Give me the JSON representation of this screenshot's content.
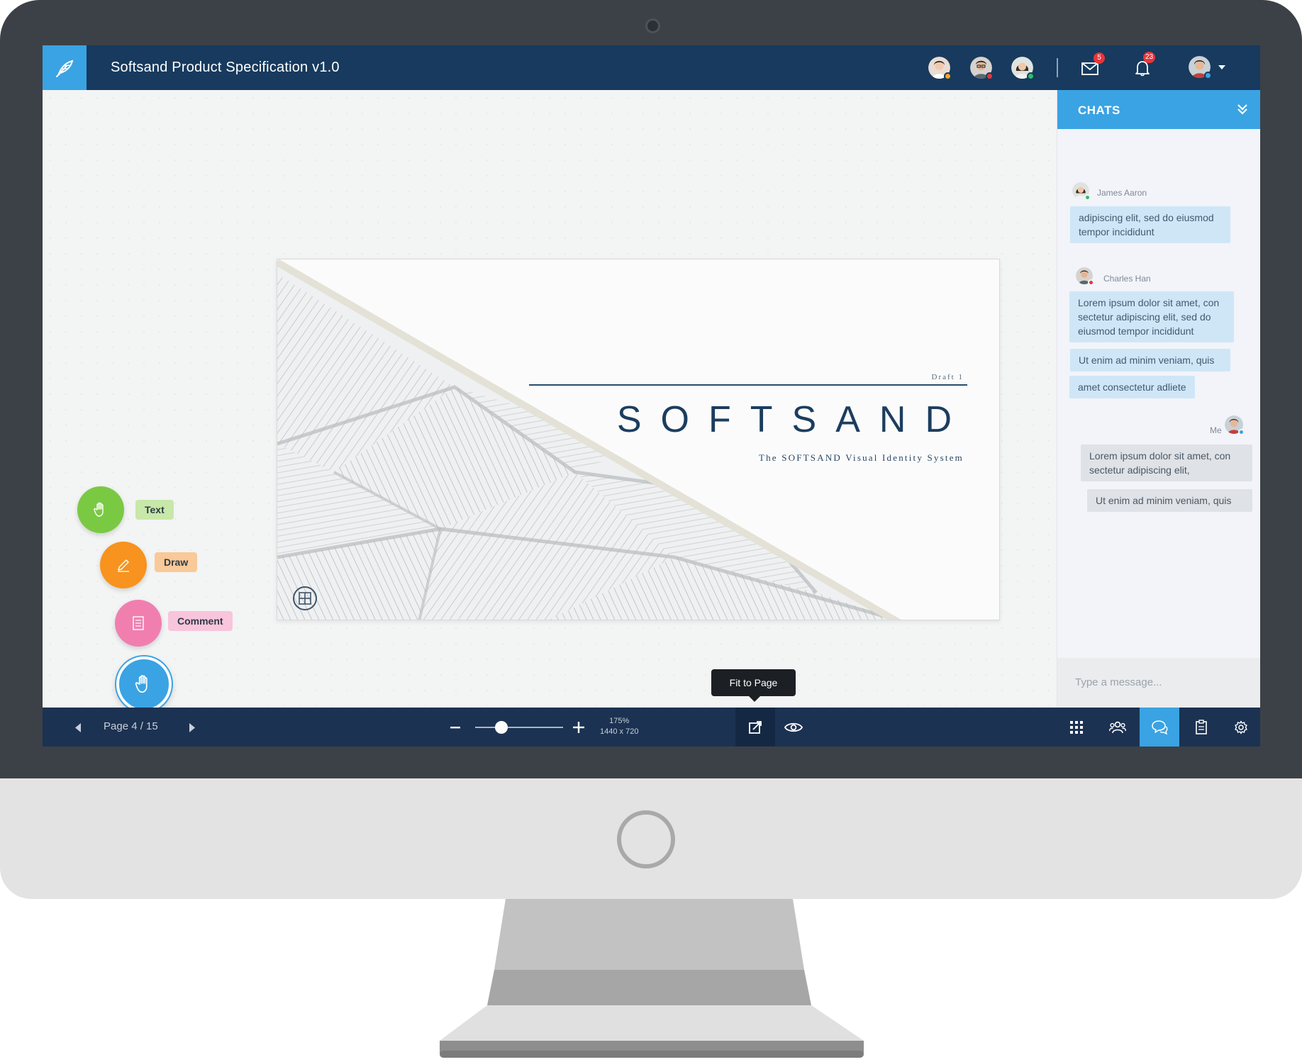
{
  "app": {
    "document_title": "Softsand Product Specification v1.0"
  },
  "header": {
    "collaborators": [
      {
        "avatar": "collaborator-avatar-1",
        "status_color": "#f5a623"
      },
      {
        "avatar": "collaborator-avatar-2",
        "status_color": "#e8343a"
      },
      {
        "avatar": "collaborator-avatar-3",
        "status_color": "#2bbf6a"
      }
    ],
    "mail_badge": "5",
    "notification_badge": "23",
    "user_status_color": "#3aa3e3"
  },
  "slide": {
    "draft_label": "Draft 1",
    "brand": "SOFTSAND",
    "tagline": "The SOFTSAND Visual Identity System"
  },
  "tools": {
    "text_label": "Text",
    "draw_label": "Draw",
    "comment_label": "Comment",
    "colors": {
      "text": "#7ac943",
      "draw": "#f7931e",
      "comment": "#f07fb0",
      "hand": "#3aa3e3"
    }
  },
  "tooltip": {
    "label": "Fit to Page"
  },
  "bottombar": {
    "page_label": "Page 4 / 15",
    "zoom_percent": "175%",
    "resolution": "1440 x 720",
    "zoom_level": 0.3
  },
  "chat": {
    "title": "CHATS",
    "messages": [
      {
        "name": "James Aaron",
        "texts": [
          "adipiscing elit, sed do eiusmod tempor incididunt"
        ]
      },
      {
        "name": "Charles Han",
        "texts": [
          "Lorem ipsum dolor sit amet, con sectetur adipiscing elit, sed do eiusmod tempor incididunt",
          "Ut enim ad minim veniam, quis",
          "amet consectetur adliete"
        ]
      },
      {
        "name": "Me",
        "texts": [
          "Lorem ipsum dolor sit amet, con sectetur adipiscing elit,",
          "Ut enim ad minim veniam, quis"
        ]
      }
    ],
    "input_placeholder": "Type a message..."
  }
}
